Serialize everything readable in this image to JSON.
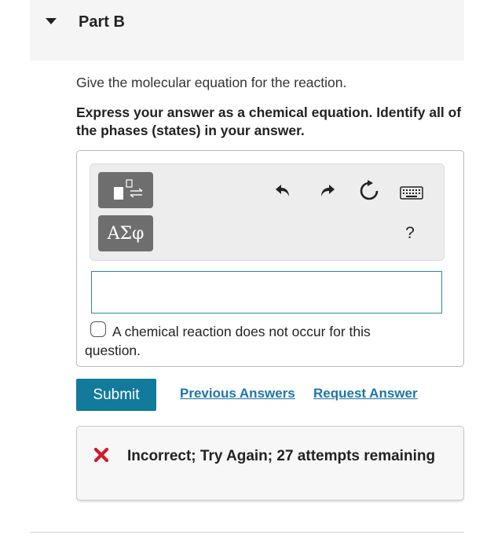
{
  "part": {
    "title": "Part B"
  },
  "question": {
    "prompt": "Give the molecular equation for the reaction.",
    "instruction": "Express your answer as a chemical equation. Identify all of the phases (states) in your answer."
  },
  "toolbar": {
    "templates_icon": "templates-icon",
    "symbols_label": "ΑΣφ",
    "undo_icon": "undo-icon",
    "redo_icon": "redo-icon",
    "reset_icon": "reset-icon",
    "keyboard_icon": "keyboard-icon",
    "help_label": "?"
  },
  "answer_input": {
    "value": ""
  },
  "no_reaction_option": {
    "checked": false,
    "label": "A chemical reaction does not occur for this question."
  },
  "actions": {
    "submit_label": "Submit",
    "previous_answers_label": "Previous Answers",
    "request_answer_label": "Request Answer"
  },
  "feedback": {
    "icon": "x-icon",
    "message": "Incorrect; Try Again; 27 attempts remaining"
  },
  "colors": {
    "accent": "#127a9b",
    "link": "#1d75a8",
    "error": "#d4192b",
    "input_border": "#2a8aa6"
  }
}
